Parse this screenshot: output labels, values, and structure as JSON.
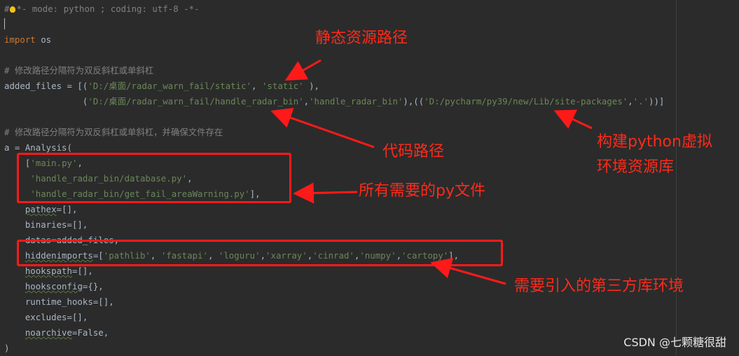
{
  "code_lines": [
    {
      "segments": [
        {
          "t": "#",
          "c": "cm"
        },
        {
          "t": "",
          "c": "bulb"
        },
        {
          "t": "*- mode: python ; coding: utf-8 -*-",
          "c": "cm"
        }
      ]
    },
    {
      "segments": [
        {
          "t": "",
          "c": "caret"
        }
      ]
    },
    {
      "segments": [
        {
          "t": "import",
          "c": "kw"
        },
        {
          "t": " os",
          "c": ""
        }
      ]
    },
    {
      "segments": []
    },
    {
      "segments": [
        {
          "t": "# 修改路径分隔符为双反斜杠或单斜杠",
          "c": "cm"
        }
      ]
    },
    {
      "segments": [
        {
          "t": "added_files = [(",
          "c": ""
        },
        {
          "t": "'D:/桌面/radar_warn_fail/static'",
          "c": "str"
        },
        {
          "t": ", ",
          "c": ""
        },
        {
          "t": "'static'",
          "c": "str"
        },
        {
          "t": " ),",
          "c": ""
        }
      ]
    },
    {
      "segments": [
        {
          "t": "               (",
          "c": ""
        },
        {
          "t": "'D:/桌面/radar_warn_fail/handle_radar_bin'",
          "c": "str"
        },
        {
          "t": ",",
          "c": ""
        },
        {
          "t": "'handle_radar_bin'",
          "c": "str"
        },
        {
          "t": "),((",
          "c": ""
        },
        {
          "t": "'D:/pycharm/py39/new/Lib/site-packages'",
          "c": "str"
        },
        {
          "t": ",",
          "c": ""
        },
        {
          "t": "'.'",
          "c": "str"
        },
        {
          "t": "))]",
          "c": ""
        }
      ]
    },
    {
      "segments": []
    },
    {
      "segments": [
        {
          "t": "# 修改路径分隔符为双反斜杠或单斜杠，并确保文件存在",
          "c": "cm"
        }
      ]
    },
    {
      "segments": [
        {
          "t": "a = Analysis(",
          "c": ""
        }
      ]
    },
    {
      "segments": [
        {
          "t": "    [",
          "c": ""
        },
        {
          "t": "'main.py'",
          "c": "str"
        },
        {
          "t": ",",
          "c": ""
        }
      ]
    },
    {
      "segments": [
        {
          "t": "     ",
          "c": ""
        },
        {
          "t": "'handle_radar_bin/database.py'",
          "c": "str"
        },
        {
          "t": ",",
          "c": ""
        }
      ]
    },
    {
      "segments": [
        {
          "t": "     ",
          "c": ""
        },
        {
          "t": "'handle_radar_bin/get_fail_areaWarning.py'",
          "c": "str"
        },
        {
          "t": "],",
          "c": ""
        }
      ]
    },
    {
      "segments": [
        {
          "t": "    ",
          "c": ""
        },
        {
          "t": "pathex",
          "c": "squig"
        },
        {
          "t": "=[],",
          "c": ""
        }
      ]
    },
    {
      "segments": [
        {
          "t": "    binaries=[],",
          "c": ""
        }
      ]
    },
    {
      "segments": [
        {
          "t": "    datas=added_files,",
          "c": ""
        }
      ]
    },
    {
      "segments": [
        {
          "t": "    ",
          "c": ""
        },
        {
          "t": "hiddenimports",
          "c": "squig"
        },
        {
          "t": "=[",
          "c": ""
        },
        {
          "t": "'pathlib'",
          "c": "str"
        },
        {
          "t": ", ",
          "c": ""
        },
        {
          "t": "'fastapi'",
          "c": "str"
        },
        {
          "t": ", ",
          "c": ""
        },
        {
          "t": "'loguru'",
          "c": "str"
        },
        {
          "t": ",",
          "c": ""
        },
        {
          "t": "'xarray'",
          "c": "str"
        },
        {
          "t": ",",
          "c": ""
        },
        {
          "t": "'cinrad'",
          "c": "str"
        },
        {
          "t": ",",
          "c": ""
        },
        {
          "t": "'numpy'",
          "c": "str"
        },
        {
          "t": ",",
          "c": ""
        },
        {
          "t": "'cartopy'",
          "c": "str"
        },
        {
          "t": "],",
          "c": ""
        }
      ]
    },
    {
      "segments": [
        {
          "t": "    ",
          "c": ""
        },
        {
          "t": "hookspath",
          "c": "squig"
        },
        {
          "t": "=[],",
          "c": ""
        }
      ]
    },
    {
      "segments": [
        {
          "t": "    ",
          "c": ""
        },
        {
          "t": "hooksconfig",
          "c": "squig"
        },
        {
          "t": "={},",
          "c": ""
        }
      ]
    },
    {
      "segments": [
        {
          "t": "    runtime_hooks=[],",
          "c": ""
        }
      ]
    },
    {
      "segments": [
        {
          "t": "    excludes=[],",
          "c": ""
        }
      ]
    },
    {
      "segments": [
        {
          "t": "    ",
          "c": ""
        },
        {
          "t": "noarchive",
          "c": "squig"
        },
        {
          "t": "=False,",
          "c": ""
        }
      ]
    },
    {
      "segments": [
        {
          "t": ")",
          "c": ""
        }
      ]
    }
  ],
  "annotations": {
    "static_path": "静态资源路径",
    "code_path": "代码路径",
    "venv_lib_line1": "构建python虚拟",
    "venv_lib_line2": "环境资源库",
    "py_files": "所有需要的py文件",
    "third_party": "需要引入的第三方库环境"
  },
  "watermark": "CSDN @七颗糖很甜",
  "colors": {
    "background": "#2b2b2b",
    "annotation_red": "#ff2a1a",
    "string_green": "#6a8759",
    "keyword_orange": "#cc7832",
    "comment_gray": "#808080"
  },
  "icons": [
    "lightbulb-icon"
  ]
}
